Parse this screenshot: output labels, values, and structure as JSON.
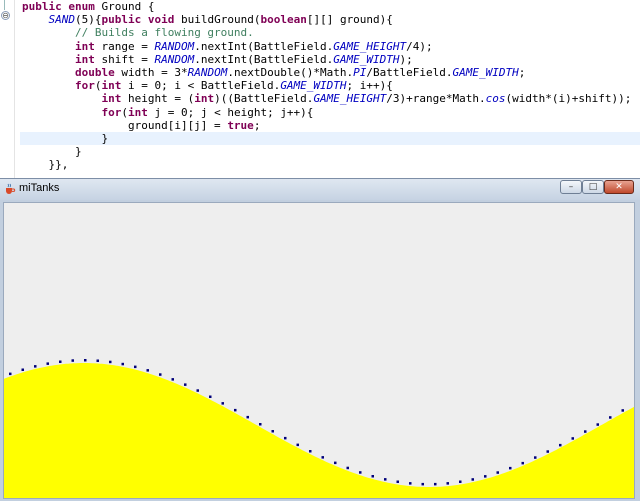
{
  "editor": {
    "lines": [
      {
        "parts": [
          {
            "t": "public enum ",
            "c": "kw"
          },
          {
            "t": "Ground {",
            "c": "fb"
          }
        ]
      },
      {
        "parts": [
          {
            "t": "    ",
            "c": "fb"
          },
          {
            "t": "SAND",
            "c": "en"
          },
          {
            "t": "(5){",
            "c": "fb"
          },
          {
            "t": "public void ",
            "c": "kw"
          },
          {
            "t": "buildGround(",
            "c": "fb"
          },
          {
            "t": "boolean",
            "c": "kw"
          },
          {
            "t": "[][] ground){",
            "c": "fb"
          }
        ]
      },
      {
        "parts": [
          {
            "t": "        ",
            "c": "fb"
          },
          {
            "t": "// Builds a flowing ground.",
            "c": "cm"
          }
        ]
      },
      {
        "parts": [
          {
            "t": "        ",
            "c": "fb"
          },
          {
            "t": "int ",
            "c": "kw"
          },
          {
            "t": "range = ",
            "c": "fb"
          },
          {
            "t": "RANDOM",
            "c": "st"
          },
          {
            "t": ".nextInt(BattleField.",
            "c": "fb"
          },
          {
            "t": "GAME_HEIGHT",
            "c": "st"
          },
          {
            "t": "/4);",
            "c": "fb"
          }
        ]
      },
      {
        "parts": [
          {
            "t": "        ",
            "c": "fb"
          },
          {
            "t": "int ",
            "c": "kw"
          },
          {
            "t": "shift = ",
            "c": "fb"
          },
          {
            "t": "RANDOM",
            "c": "st"
          },
          {
            "t": ".nextInt(BattleField.",
            "c": "fb"
          },
          {
            "t": "GAME_WIDTH",
            "c": "st"
          },
          {
            "t": ");",
            "c": "fb"
          }
        ]
      },
      {
        "parts": [
          {
            "t": "        ",
            "c": "fb"
          },
          {
            "t": "double ",
            "c": "kw"
          },
          {
            "t": "width = 3*",
            "c": "fb"
          },
          {
            "t": "RANDOM",
            "c": "st"
          },
          {
            "t": ".nextDouble()*Math.",
            "c": "fb"
          },
          {
            "t": "PI",
            "c": "st"
          },
          {
            "t": "/BattleField.",
            "c": "fb"
          },
          {
            "t": "GAME_WIDTH",
            "c": "st"
          },
          {
            "t": ";",
            "c": "fb"
          }
        ]
      },
      {
        "parts": [
          {
            "t": "        ",
            "c": "fb"
          },
          {
            "t": "for",
            "c": "kw"
          },
          {
            "t": "(",
            "c": "fb"
          },
          {
            "t": "int ",
            "c": "kw"
          },
          {
            "t": "i = 0; i < BattleField.",
            "c": "fb"
          },
          {
            "t": "GAME_WIDTH",
            "c": "st"
          },
          {
            "t": "; i++){",
            "c": "fb"
          }
        ]
      },
      {
        "parts": [
          {
            "t": "            ",
            "c": "fb"
          },
          {
            "t": "int ",
            "c": "kw"
          },
          {
            "t": "height = (",
            "c": "fb"
          },
          {
            "t": "int",
            "c": "kw"
          },
          {
            "t": ")((BattleField.",
            "c": "fb"
          },
          {
            "t": "GAME_HEIGHT",
            "c": "st"
          },
          {
            "t": "/3)+range*Math.",
            "c": "fb"
          },
          {
            "t": "cos",
            "c": "st"
          },
          {
            "t": "(width*(i)+shift));",
            "c": "fb"
          }
        ]
      },
      {
        "parts": [
          {
            "t": "            ",
            "c": "fb"
          },
          {
            "t": "for",
            "c": "kw"
          },
          {
            "t": "(",
            "c": "fb"
          },
          {
            "t": "int ",
            "c": "kw"
          },
          {
            "t": "j = 0; j < height; j++){",
            "c": "fb"
          }
        ]
      },
      {
        "parts": [
          {
            "t": "                ground[i][j] = ",
            "c": "fb"
          },
          {
            "t": "true",
            "c": "kw"
          },
          {
            "t": ";",
            "c": "fb"
          }
        ]
      },
      {
        "parts": [
          {
            "t": "            }",
            "c": "fb"
          }
        ],
        "highlight": true
      },
      {
        "parts": [
          {
            "t": "        }",
            "c": "fb"
          }
        ]
      },
      {
        "parts": [
          {
            "t": "    }},",
            "c": "fb"
          }
        ]
      }
    ]
  },
  "window": {
    "title": "miTanks",
    "buttons": {
      "minimize": "–",
      "maximize": "□",
      "close": "✕"
    },
    "icons": {
      "app": "java-cup-icon"
    }
  },
  "colors": {
    "ground": "#ffff00",
    "sky": "#eeeeee",
    "outline_dots": "#00007a"
  }
}
